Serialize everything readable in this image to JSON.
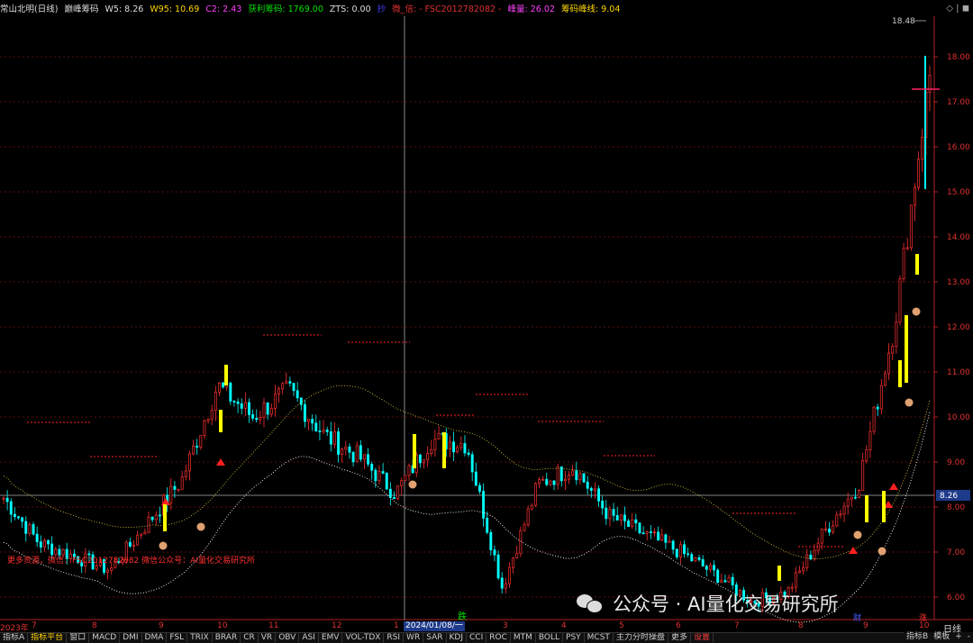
{
  "header": {
    "stock": "常山北明(日线)",
    "indicator": "巅峰筹码",
    "w5": "W5: 8.26",
    "w95": "W95: 10.69",
    "c2": "C2: 2.43",
    "profit": "获利筹码: 1769.00",
    "zts": "ZTS: 0.00",
    "cq": "抄",
    "wechat": "微_信: - FSC2012782082 -",
    "peak": "峰量: 26.02",
    "peakline": "筹码峰线: 9.04",
    "controls": "◇ | ◼"
  },
  "watermark": {
    "text": "公众号 · AI量化交易研究所",
    "icon": "wechat-icon"
  },
  "promo": "更多资源，微信：FSC2012782082 微信公众号：AI量化交易研究所",
  "current_price_label": "8.26",
  "high_label": "18.48",
  "date_box": "2024/01/08/一",
  "period": "日线",
  "markers": {
    "die": "跌",
    "cai": "财",
    "zhang": "涨"
  },
  "xaxis": [
    {
      "label": "2023年",
      "x": 0
    },
    {
      "label": "7",
      "x": 35
    },
    {
      "label": "8",
      "x": 102
    },
    {
      "label": "9",
      "x": 176
    },
    {
      "label": "10",
      "x": 241
    },
    {
      "label": "11",
      "x": 298
    },
    {
      "label": "12",
      "x": 368
    },
    {
      "label": "1",
      "x": 437
    },
    {
      "label": "2",
      "x": 508
    },
    {
      "label": "3",
      "x": 558
    },
    {
      "label": "4",
      "x": 623
    },
    {
      "label": "5",
      "x": 687
    },
    {
      "label": "6",
      "x": 750
    },
    {
      "label": "7",
      "x": 815
    },
    {
      "label": "8",
      "x": 886
    },
    {
      "label": "9",
      "x": 958
    },
    {
      "label": "10",
      "x": 1020
    }
  ],
  "tabs": [
    "指标A",
    "指标平台",
    "窗口",
    "MACD",
    "DMI",
    "DMA",
    "FSL",
    "TRIX",
    "BRAR",
    "CR",
    "VR",
    "OBV",
    "ASI",
    "EMV",
    "VOL-TDX",
    "RSI",
    "WR",
    "SAR",
    "KDJ",
    "CCI",
    "ROC",
    "MTM",
    "BOLL",
    "PSY",
    "MCST",
    "主力分时操盘",
    "更多",
    "设置"
  ],
  "right_tabs": [
    "指标B",
    "模板",
    "+",
    "-"
  ],
  "chart_data": {
    "type": "candlestick",
    "title": "常山北明(日线)",
    "ylim": [
      5.5,
      18.9
    ],
    "yticks": [
      6,
      7,
      8,
      9,
      10,
      11,
      12,
      13,
      14,
      15,
      16,
      17,
      18
    ],
    "current_price": 8.26,
    "period_high": 18.48,
    "approx_close_path": [
      [
        "2023-06",
        8.2
      ],
      [
        "2023-07",
        7.2
      ],
      [
        "2023-08",
        6.9
      ],
      [
        "2023-08-end",
        6.6
      ],
      [
        "2023-09",
        7.6
      ],
      [
        "2023-09-end",
        8.6
      ],
      [
        "2023-10",
        10.7
      ],
      [
        "2023-10-mid",
        10.0
      ],
      [
        "2023-11",
        10.6
      ],
      [
        "2023-11-mid",
        9.6
      ],
      [
        "2023-12",
        9.1
      ],
      [
        "2023-12-end",
        8.3
      ],
      [
        "2024-01-08",
        9.5
      ],
      [
        "2024-01-end",
        9.4
      ],
      [
        "2024-02",
        6.2
      ],
      [
        "2024-03",
        8.5
      ],
      [
        "2024-03-end",
        8.9
      ],
      [
        "2024-04",
        7.8
      ],
      [
        "2024-05",
        7.4
      ],
      [
        "2024-06",
        7.0
      ],
      [
        "2024-07",
        6.5
      ],
      [
        "2024-07-end",
        5.9
      ],
      [
        "2024-08",
        6.1
      ],
      [
        "2024-09",
        7.4
      ],
      [
        "2024-09-end",
        8.5
      ],
      [
        "2024-10",
        12.0
      ],
      [
        "2024-10-end",
        17.6
      ]
    ]
  }
}
